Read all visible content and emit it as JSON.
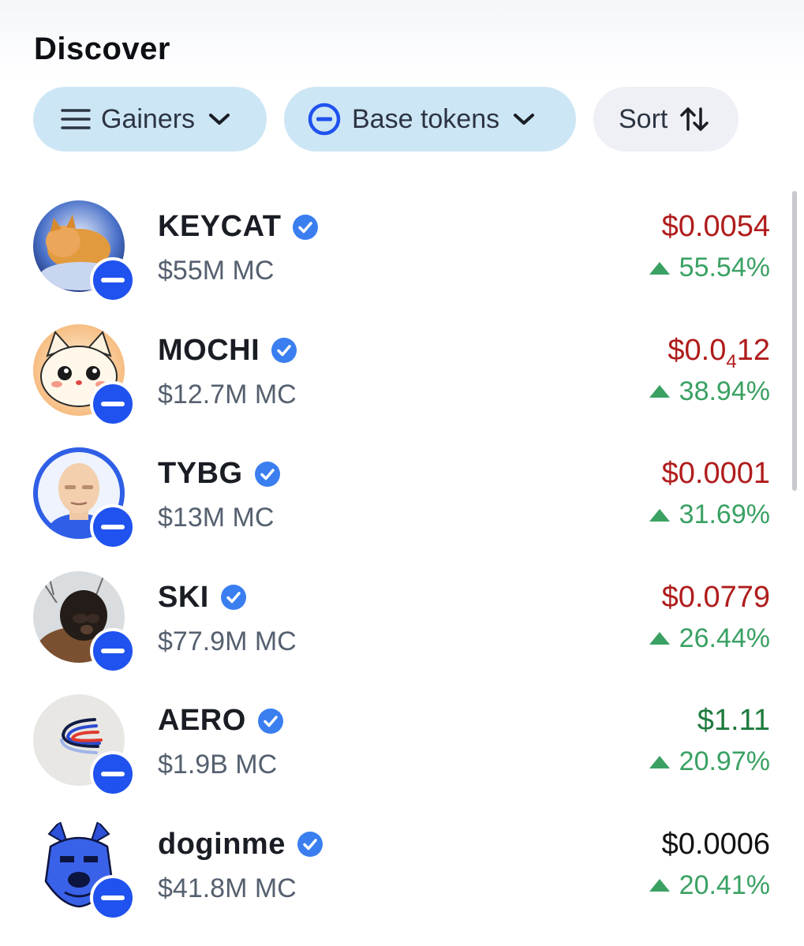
{
  "header": {
    "title": "Discover"
  },
  "filters": {
    "gainers": {
      "label": "Gainers",
      "icon": "menu-icon"
    },
    "network": {
      "label": "Base tokens",
      "icon": "base-network-icon"
    },
    "sort": {
      "label": "Sort",
      "icon": "sort-arrows-icon"
    }
  },
  "colors": {
    "chip_primary": "#cde6f6",
    "chip_secondary": "#eef0f5",
    "price_down": "#b01c1c",
    "price_up": "#1f7a3e",
    "change_up": "#3aa163",
    "verified": "#3a7ef0",
    "base_blue": "#1f52ee"
  },
  "tokens": [
    {
      "name": "KEYCAT",
      "market_cap": "$55M MC",
      "price": "$0.0054",
      "change": "55.54%",
      "price_color": "red",
      "avatar": "keycat-avatar"
    },
    {
      "name": "MOCHI",
      "market_cap": "$12.7M MC",
      "price_prefix": "$0.0",
      "price_subscript": "4",
      "price_suffix": "12",
      "change": "38.94%",
      "price_color": "red",
      "avatar": "mochi-avatar"
    },
    {
      "name": "TYBG",
      "market_cap": "$13M MC",
      "price": "$0.0001",
      "change": "31.69%",
      "price_color": "red",
      "avatar": "tybg-avatar"
    },
    {
      "name": "SKI",
      "market_cap": "$77.9M MC",
      "price": "$0.0779",
      "change": "26.44%",
      "price_color": "red",
      "avatar": "ski-avatar"
    },
    {
      "name": "AERO",
      "market_cap": "$1.9B MC",
      "price": "$1.11",
      "change": "20.97%",
      "price_color": "green",
      "avatar": "aero-avatar"
    },
    {
      "name": "doginme",
      "market_cap": "$41.8M MC",
      "price": "$0.0006",
      "change": "20.41%",
      "price_color": "black",
      "avatar": "doginme-avatar"
    }
  ]
}
